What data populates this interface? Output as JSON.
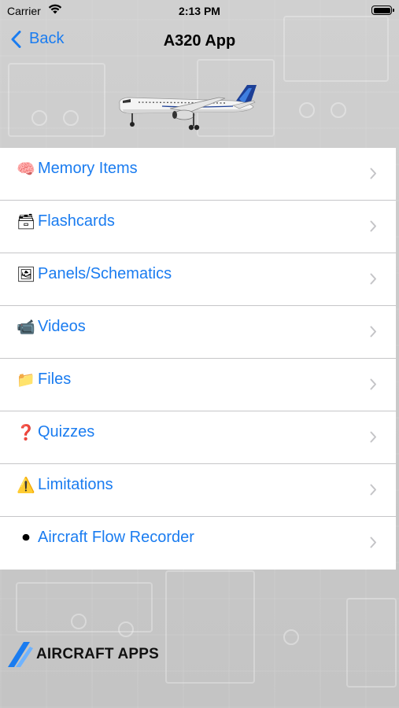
{
  "status_bar": {
    "carrier": "Carrier",
    "time": "2:13 PM"
  },
  "nav": {
    "back_label": "Back",
    "title": "A320 App"
  },
  "menu": {
    "items": [
      {
        "label": "Memory Items",
        "icon": "brain-icon",
        "emoji": "🧠"
      },
      {
        "label": "Flashcards",
        "icon": "card-file-box-icon",
        "emoji": "🗃"
      },
      {
        "label": "Panels/Schematics",
        "icon": "framed-picture-icon",
        "emoji": "🖼"
      },
      {
        "label": "Videos",
        "icon": "video-camera-icon",
        "emoji": "📹"
      },
      {
        "label": "Files",
        "icon": "folder-icon",
        "emoji": "📁"
      },
      {
        "label": "Quizzes",
        "icon": "question-mark-icon",
        "emoji": "❓"
      },
      {
        "label": "Limitations",
        "icon": "warning-icon",
        "emoji": "⚠️"
      },
      {
        "label": "Aircraft Flow Recorder",
        "icon": "record-button-icon",
        "emoji": "⏺"
      }
    ]
  },
  "logo": {
    "text": "AIRCRAFT APPS"
  },
  "colors": {
    "accent": "#1a7cf0",
    "list_background": "#ffffff",
    "separator": "#c6c6c8",
    "page_background": "#c9c9c9"
  }
}
